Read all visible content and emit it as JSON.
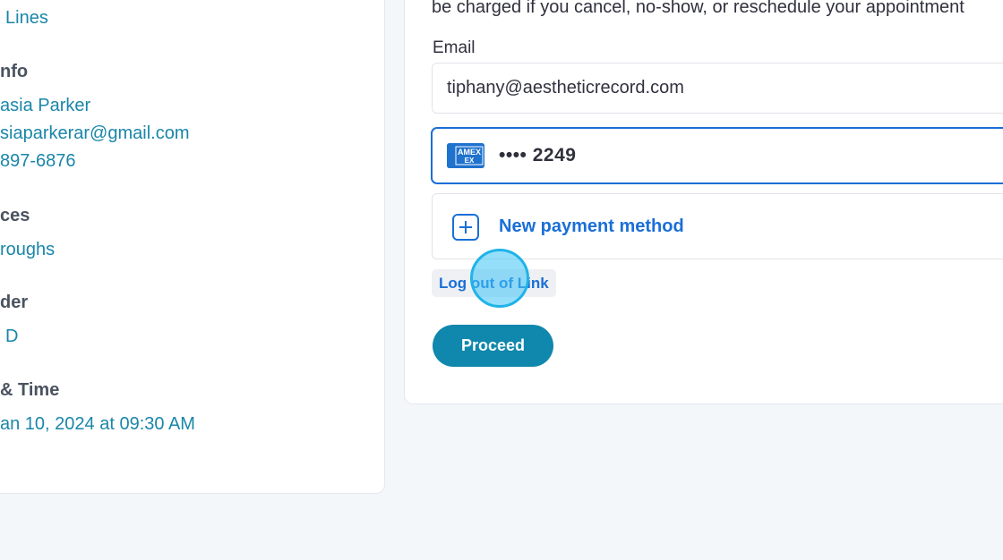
{
  "summary": {
    "items": [
      {
        "label": "",
        "value": "Lines"
      },
      {
        "label": "nfo",
        "value": ""
      },
      {
        "label": "",
        "value": "asia Parker"
      },
      {
        "label": "",
        "value": "siaparkerar@gmail.com"
      },
      {
        "label": "",
        "value": "897-6876"
      },
      {
        "label": "ces",
        "value": ""
      },
      {
        "label": "",
        "value": "roughs"
      },
      {
        "label": "der",
        "value": ""
      },
      {
        "label": "",
        "value": "D"
      },
      {
        "label": "& Time",
        "value": ""
      },
      {
        "label": "",
        "value": "an 10, 2024 at 09:30 AM"
      }
    ]
  },
  "payment": {
    "notice": "be charged if you cancel, no-show, or reschedule your appointment",
    "email_label": "Email",
    "email_value": "tiphany@aestheticrecord.com",
    "card_brand": "AMEX",
    "card_masked": "•••• 2249",
    "new_payment_label": "New payment method",
    "logout_label": "Log out of Link",
    "proceed_label": "Proceed"
  },
  "colors": {
    "accent": "#1a6fd6",
    "primary_button": "#1087ad",
    "link_text": "#1a86a8",
    "click_marker": "#40c4f5"
  },
  "icons": {
    "card": "amex-card-icon",
    "add": "plus-icon"
  }
}
